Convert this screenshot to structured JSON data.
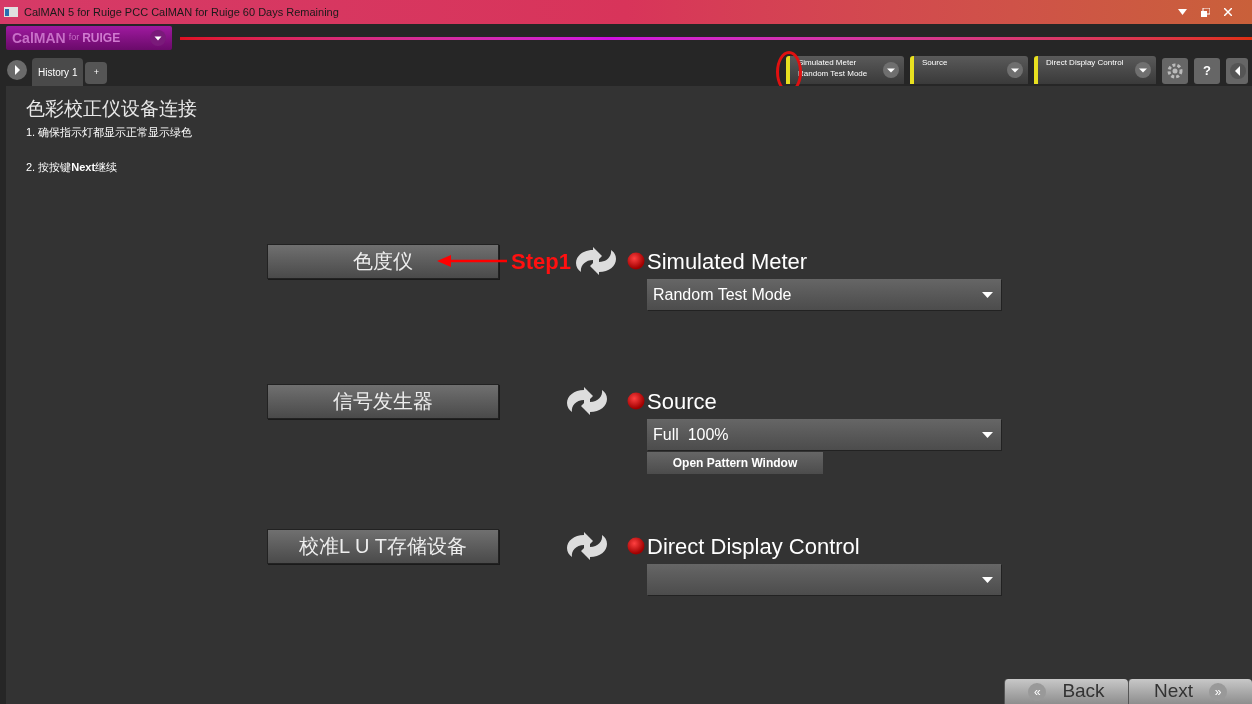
{
  "window": {
    "title": "CalMAN 5 for Ruige PCC CalMAN for Ruige 60 Days Remaining"
  },
  "logo": {
    "brand": "CalMAN",
    "connector": "for",
    "partner": "RUIGE"
  },
  "tabs": [
    {
      "label": "History 1",
      "selected": true
    }
  ],
  "add_tab": "+",
  "toolbar": {
    "devices": [
      {
        "lines": [
          "Simulated Meter",
          "Random Test Mode"
        ],
        "annotated": true
      },
      {
        "lines": [
          "Source"
        ],
        "annotated": false
      },
      {
        "lines": [
          "Direct Display Control"
        ],
        "annotated": false
      }
    ],
    "help": "?"
  },
  "page": {
    "heading": "色彩校正仪设备连接",
    "steps": [
      "1. 确保指示灯都显示正常显示绿色",
      "2. 按按键**Next**继续"
    ]
  },
  "devices": [
    {
      "button": "色度仪",
      "annotation": "Step1",
      "name": "Simulated Meter",
      "selection": "Random Test Mode"
    },
    {
      "button": "信号发生器",
      "name": "Source",
      "selection": "Full  100%",
      "action": "Open Pattern Window"
    },
    {
      "button": "校准L U T存储设备",
      "name": "Direct Display Control"
    }
  ],
  "nav": {
    "back": "Back",
    "back_icon": "«",
    "next": "Next",
    "next_icon": "»"
  }
}
